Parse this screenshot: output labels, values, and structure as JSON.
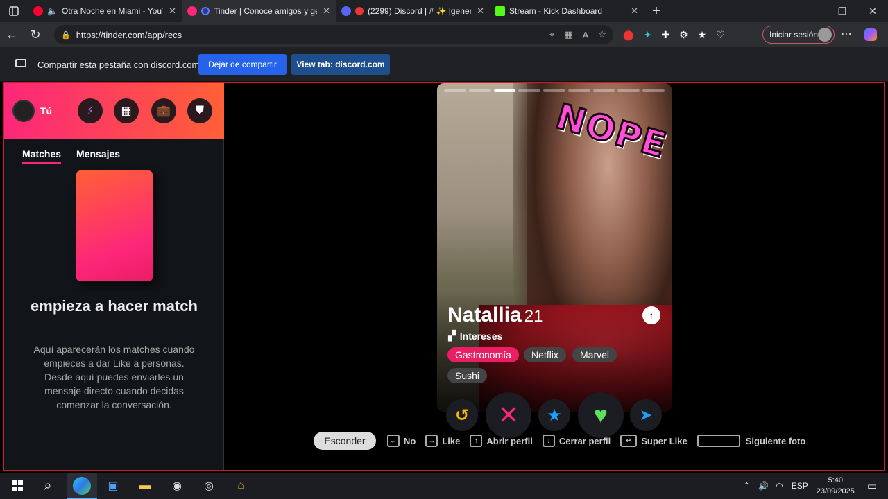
{
  "browser": {
    "tabs": [
      {
        "title": "Otra Noche en Miami - YouT",
        "active": false,
        "color": "#ff0033"
      },
      {
        "title": "Tinder | Conoce amigos y ge",
        "active": true,
        "color": "#fd267a"
      },
      {
        "title": "(2299) Discord | # ✨ |genera",
        "active": false,
        "color": "#5865f2"
      },
      {
        "title": "Stream - Kick Dashboard",
        "active": false,
        "color": "#53fc18"
      }
    ],
    "url": "https://tinder.com/app/recs",
    "signin_label": "Iniciar sesión"
  },
  "share_bar": {
    "text": "Compartir esta pestaña con discord.com",
    "stop_label": "Dejar de compartir",
    "view_label": "View tab: discord.com"
  },
  "sidebar": {
    "me_label": "Tú",
    "tabs": [
      "Matches",
      "Mensajes"
    ],
    "empty_title": "empieza a hacer match",
    "empty_desc": "Aquí aparecerán los matches cuando empieces a dar Like a personas. Desde aquí puedes enviarles un mensaje directo cuando decidas comenzar la conversación."
  },
  "card": {
    "name": "Natallia",
    "age": "21",
    "stamp": "NOPE",
    "interests_label": "Intereses",
    "interests": [
      "Gastronomía",
      "Netflix",
      "Marvel",
      "Sushi"
    ],
    "photo_count": 9,
    "current_photo": 3
  },
  "hints": {
    "hide_label": "Esconder",
    "no": "No",
    "like": "Like",
    "open_profile": "Abrir perfil",
    "close_profile": "Cerrar perfil",
    "super_like": "Super Like",
    "next_photo": "Siguiente foto"
  },
  "taskbar": {
    "lang": "ESP",
    "time": "5:40",
    "date": "23/09/2025"
  },
  "colors": {
    "brand_gradient_start": "#fd267a",
    "brand_gradient_end": "#ff6036",
    "border_red": "#d11a2a",
    "share_blue": "#2563eb"
  }
}
